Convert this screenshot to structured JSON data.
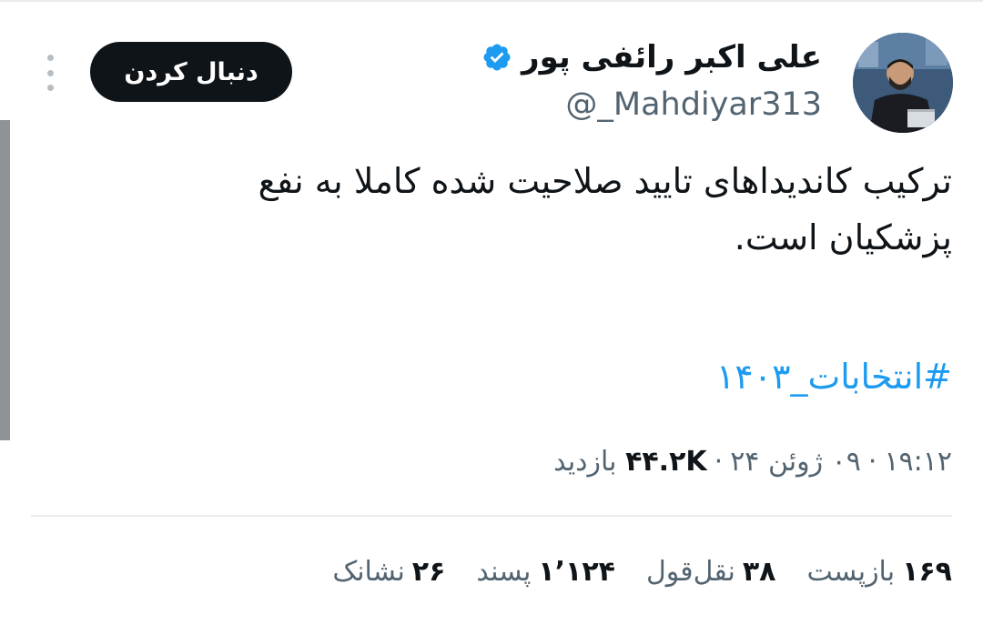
{
  "author": {
    "display_name": "علی اکبر رائفی پور",
    "handle": "@_Mahdiyar313",
    "verified": true
  },
  "follow_button": {
    "label": "دنبال کردن"
  },
  "more_menu": {
    "icon": "more-vertical-icon"
  },
  "tweet": {
    "text_line1": "ترکیب کاندیداهای تایید صلاحیت شده کاملا به نفع",
    "text_line2": "پزشکیان است.",
    "hashtag": "#انتخابات_۱۴۰۳"
  },
  "meta": {
    "time": "۱۹:۱۲",
    "date": "۰۹ ژوئن ۲۴",
    "views_count": "۴۴.۲K",
    "views_label": "بازدید"
  },
  "stats": {
    "retweets": {
      "count": "۱۶۹",
      "label": "بازپست"
    },
    "quotes": {
      "count": "۳۸",
      "label": "نقل‌قول"
    },
    "likes": {
      "count": "۱٬۱۲۴",
      "label": "پسند"
    },
    "bookmarks": {
      "count": "۲۶",
      "label": "نشانک"
    }
  },
  "colors": {
    "accent": "#1d9bf0",
    "text_primary": "#0f1419",
    "text_secondary": "#536471",
    "divider": "#e7ebee",
    "button_bg": "#0f1419"
  }
}
